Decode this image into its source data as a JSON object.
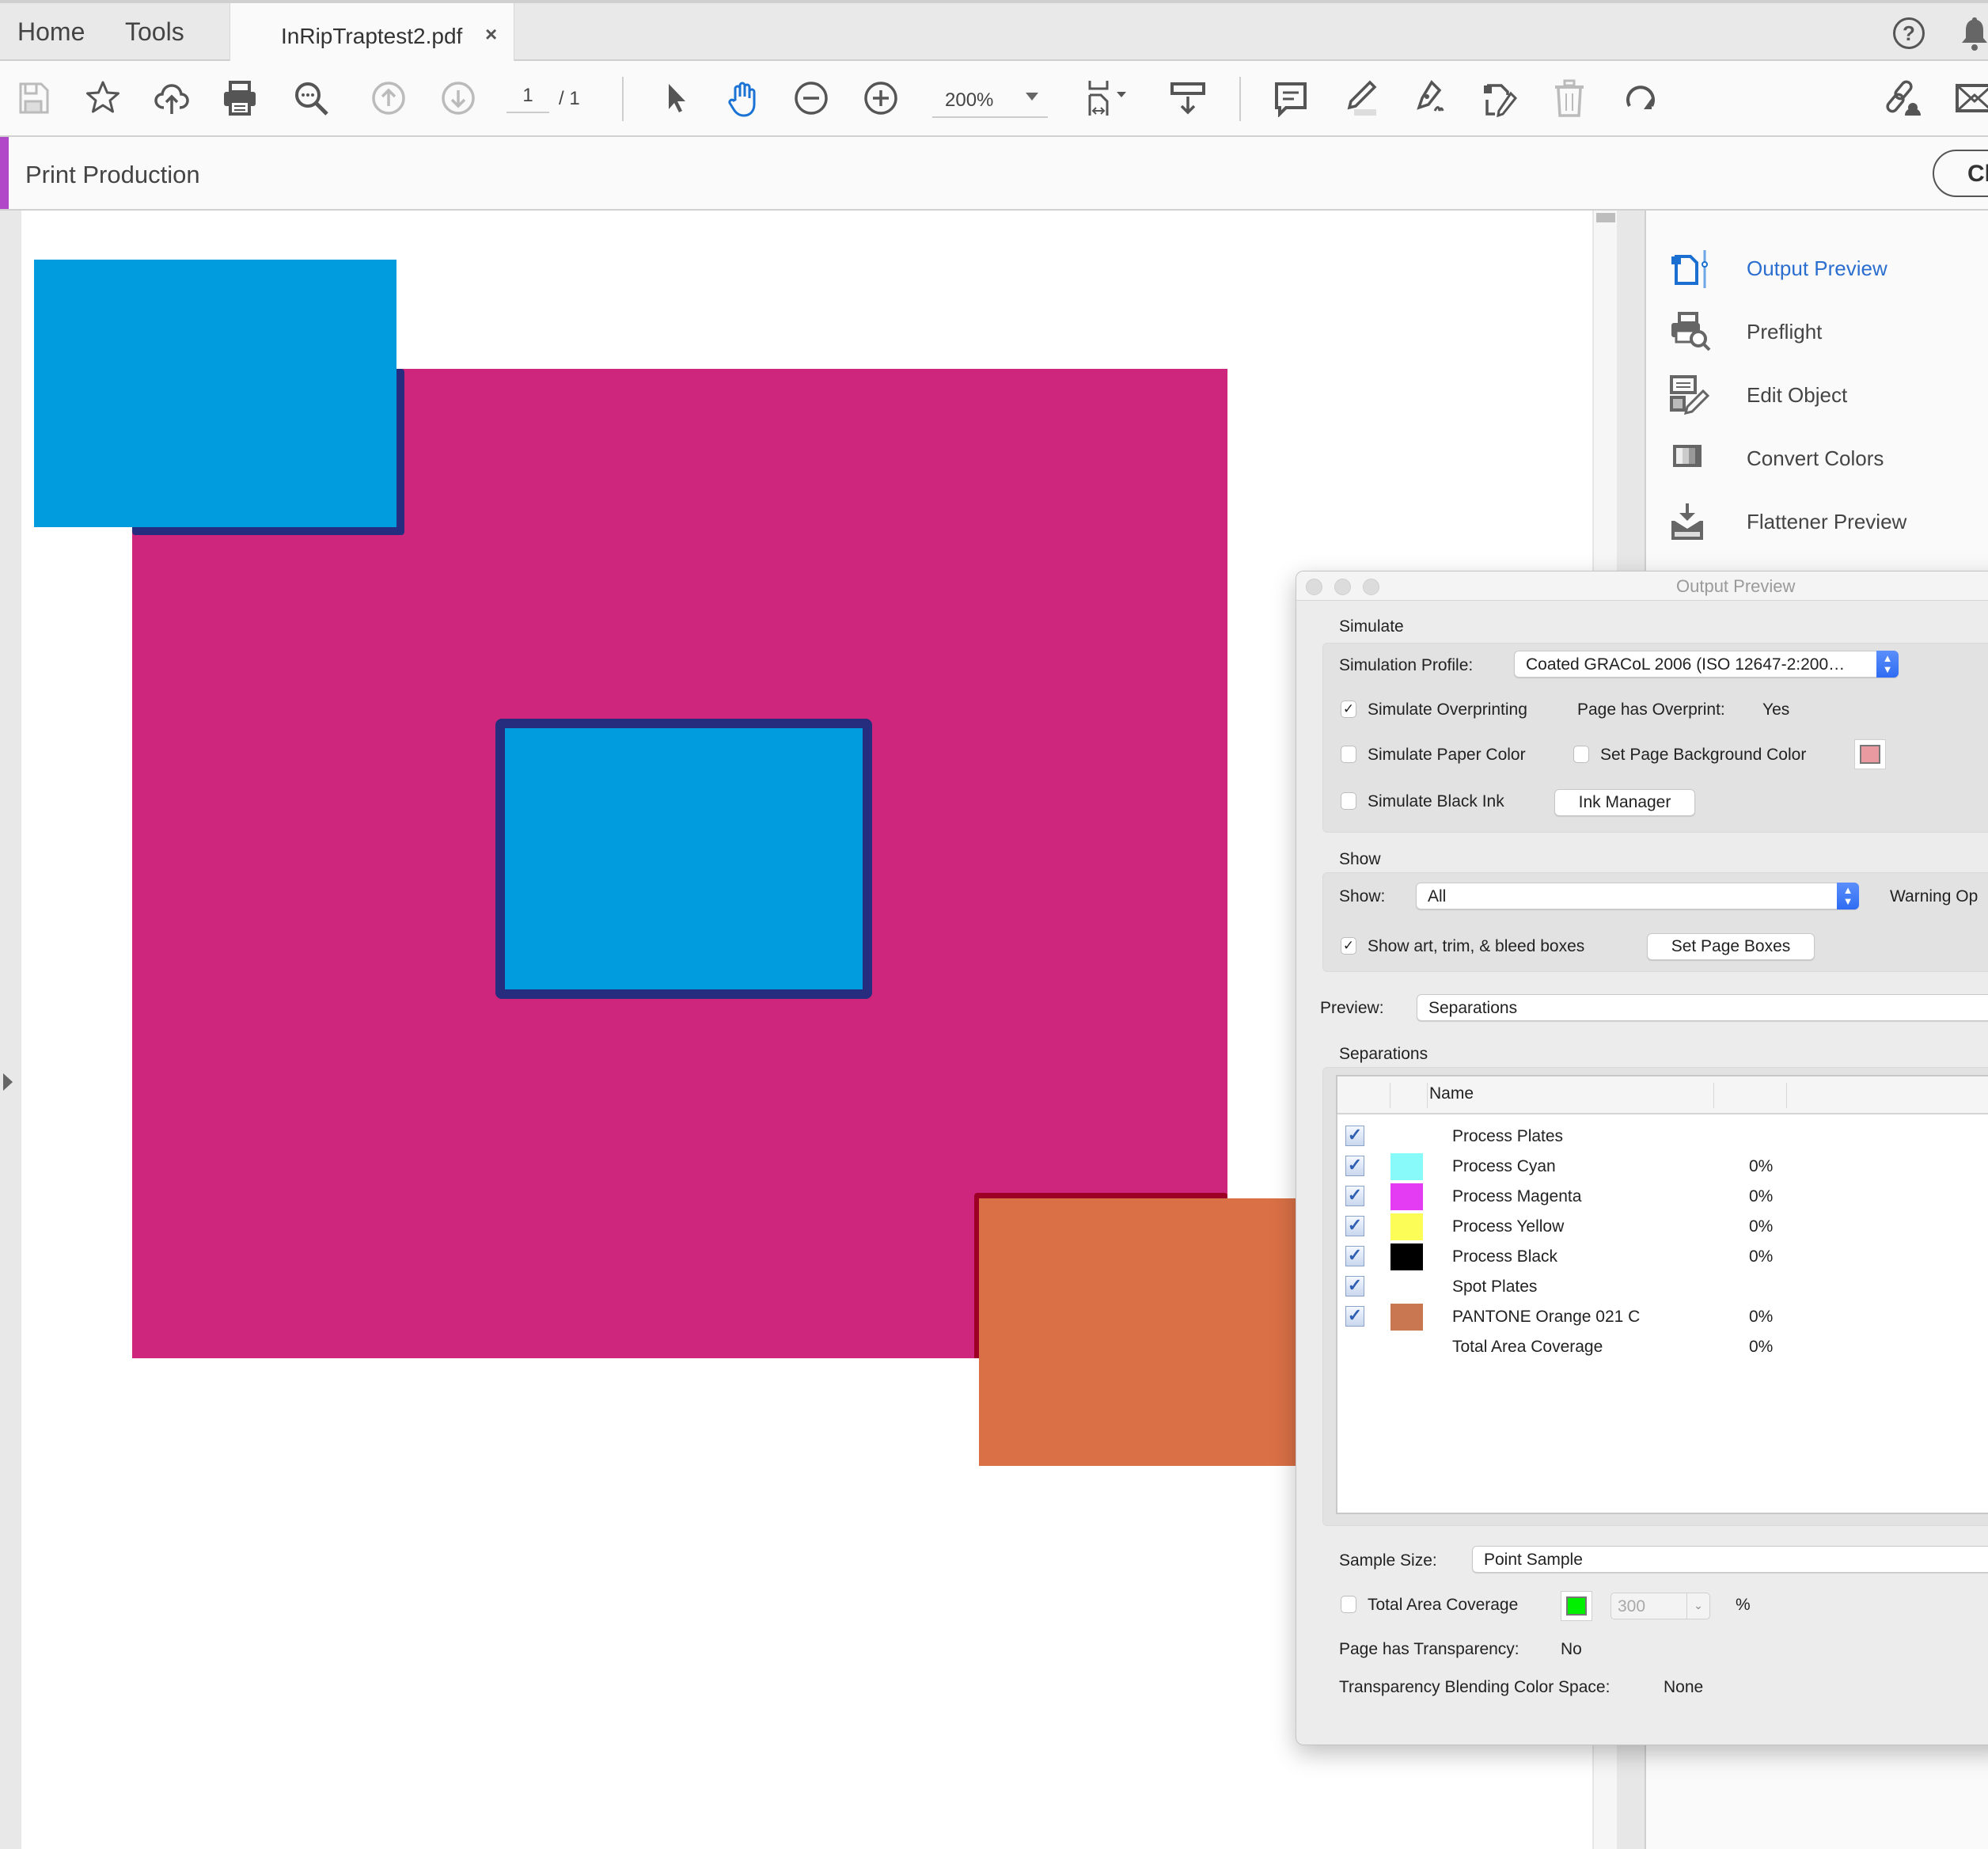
{
  "tabs": {
    "home": "Home",
    "tools": "Tools",
    "document": "InRipTraptest2.pdf",
    "close_glyph": "×"
  },
  "toolbar": {
    "page_current": "1",
    "page_total": "/ 1",
    "zoom": "200%",
    "icons": [
      "save-icon",
      "bookmark-star-icon",
      "upload-cloud-icon",
      "print-icon",
      "find-icon",
      "previous-page-icon",
      "next-page-icon",
      "select-arrow-icon",
      "hand-tool-icon",
      "zoom-out-icon",
      "zoom-in-icon",
      "fit-page-icon",
      "scroll-mode-icon",
      "comment-icon",
      "highlight-icon",
      "sign-icon",
      "edit-pdf-icon",
      "delete-icon",
      "rotate-icon",
      "share-link-icon",
      "email-icon"
    ],
    "help_glyph": "?"
  },
  "tool_header": {
    "title": "Print Production",
    "close_label": "Cl",
    "accent_color": "#b048c8"
  },
  "right_panel": {
    "items": [
      {
        "label": "Output Preview",
        "active": true
      },
      {
        "label": "Preflight"
      },
      {
        "label": "Edit Object"
      },
      {
        "label": "Convert Colors"
      },
      {
        "label": "Flattener Preview"
      }
    ]
  },
  "document": {
    "colors": {
      "cyan_fill": "#009cde",
      "magenta_fill": "#cd267c",
      "trap_dark_blue": "#262d7e",
      "orange_fill": "#d97046",
      "trap_dark_red": "#9c0024"
    }
  },
  "dialog": {
    "title": "Output Preview",
    "simulate": {
      "heading": "Simulate",
      "profile_label": "Simulation Profile:",
      "profile_value": "Coated GRACoL 2006 (ISO 12647-2:200…",
      "simulate_overprinting": {
        "label": "Simulate Overprinting",
        "checked": true
      },
      "page_has_overprint_label": "Page has Overprint:",
      "page_has_overprint_value": "Yes",
      "simulate_paper_color": {
        "label": "Simulate Paper Color",
        "checked": false
      },
      "set_page_bg_color": {
        "label": "Set Page Background Color",
        "checked": false
      },
      "page_bg_swatch": "#e99aa0",
      "simulate_black_ink": {
        "label": "Simulate Black Ink",
        "checked": false
      },
      "ink_manager_label": "Ink Manager"
    },
    "show": {
      "heading": "Show",
      "show_label": "Show:",
      "show_value": "All",
      "warning_label": "Warning Op",
      "show_boxes": {
        "label": "Show art, trim, & bleed boxes",
        "checked": true
      },
      "set_page_boxes_label": "Set Page Boxes"
    },
    "preview": {
      "label": "Preview:",
      "value": "Separations"
    },
    "separations": {
      "heading": "Separations",
      "column_name": "Name",
      "rows": [
        {
          "name": "Process Plates",
          "checked": true,
          "swatch": null,
          "pct": ""
        },
        {
          "name": "Process Cyan",
          "checked": true,
          "swatch": "#88fafa",
          "pct": "0%"
        },
        {
          "name": "Process Magenta",
          "checked": true,
          "swatch": "#e33cf2",
          "pct": "0%"
        },
        {
          "name": "Process Yellow",
          "checked": true,
          "swatch": "#fdfd57",
          "pct": "0%"
        },
        {
          "name": "Process Black",
          "checked": true,
          "swatch": "#000000",
          "pct": "0%"
        },
        {
          "name": "Spot Plates",
          "checked": true,
          "swatch": null,
          "pct": ""
        },
        {
          "name": "PANTONE Orange 021 C",
          "checked": true,
          "swatch": "#c97751",
          "pct": "0%"
        },
        {
          "name": "Total Area Coverage",
          "checked": null,
          "swatch": null,
          "pct": "0%"
        }
      ]
    },
    "sample_size": {
      "label": "Sample Size:",
      "value": "Point Sample"
    },
    "total_area_coverage": {
      "label": "Total Area Coverage",
      "checked": false,
      "swatch": "#00f000",
      "value": "300",
      "unit": "%"
    },
    "transparency": {
      "page_has_label": "Page has Transparency:",
      "page_has_value": "No",
      "blending_label": "Transparency Blending Color Space:",
      "blending_value": "None"
    }
  }
}
